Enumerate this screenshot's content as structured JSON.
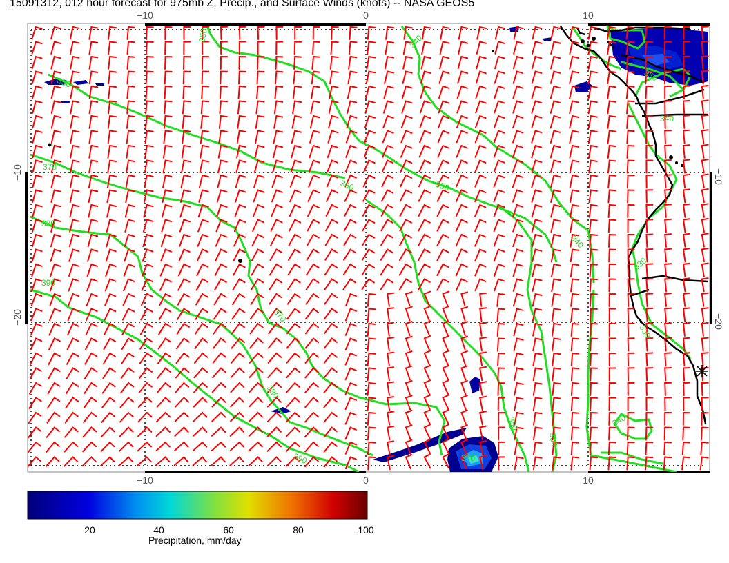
{
  "title": "15091312, 012 hour forecast for 975mb Z, Precip., and Surface Winds (knots) -- NASA GEOS5",
  "axes": {
    "top_ticks": [
      "−10",
      "0",
      "10"
    ],
    "bottom_ticks": [
      "−10",
      "0",
      "10"
    ],
    "left_ticks": [
      "−10",
      "−20"
    ],
    "right_ticks": [
      "−10",
      "−20"
    ]
  },
  "contour_labels": [
    "350",
    "340",
    "350",
    "370",
    "380",
    "350",
    "340",
    "380",
    "390",
    "370",
    "380",
    "390",
    "370",
    "350",
    "350",
    "350",
    "340",
    "330",
    "330",
    "340"
  ],
  "colorbar": {
    "label": "Precipitation, mm/day",
    "ticks": [
      "20",
      "40",
      "60",
      "80",
      "100"
    ],
    "min": 0,
    "max": 100
  },
  "colors": {
    "contour": "#22dd22",
    "wind": "#ff0000",
    "coast": "#000000",
    "precip_low": "#000080"
  }
}
